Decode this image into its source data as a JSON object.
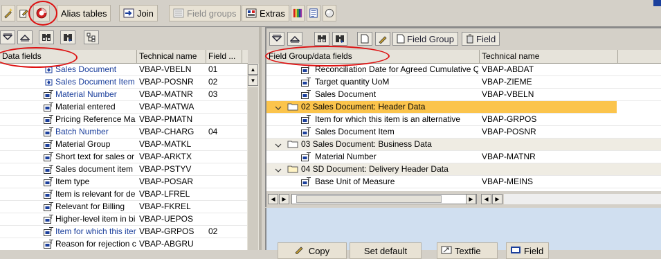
{
  "toolbar": {
    "buttons": [
      {
        "label": "Alias tables"
      },
      {
        "label": "Join"
      },
      {
        "label": "Field groups",
        "disabled": true
      },
      {
        "label": "Extras"
      }
    ]
  },
  "left": {
    "headers": [
      "Data fields",
      "Technical name",
      "Field ..."
    ],
    "rows": [
      {
        "name": "Sales Document",
        "tech": "VBAP-VBELN",
        "group": "01",
        "blue": true,
        "icon": "key-field-icon"
      },
      {
        "name": "Sales Document Item",
        "tech": "VBAP-POSNR",
        "group": "02",
        "blue": true,
        "icon": "key-field-icon"
      },
      {
        "name": "Material Number",
        "tech": "VBAP-MATNR",
        "group": "03",
        "blue": true,
        "icon": "field-icon"
      },
      {
        "name": "Material entered",
        "tech": "VBAP-MATWA",
        "group": "",
        "blue": false,
        "icon": "field-icon"
      },
      {
        "name": "Pricing Reference Ma",
        "tech": "VBAP-PMATN",
        "group": "",
        "blue": false,
        "icon": "field-icon"
      },
      {
        "name": "Batch Number",
        "tech": "VBAP-CHARG",
        "group": "04",
        "blue": true,
        "icon": "field-icon"
      },
      {
        "name": "Material Group",
        "tech": "VBAP-MATKL",
        "group": "",
        "blue": false,
        "icon": "field-icon"
      },
      {
        "name": "Short text for sales or",
        "tech": "VBAP-ARKTX",
        "group": "",
        "blue": false,
        "icon": "field-icon"
      },
      {
        "name": "Sales document item",
        "tech": "VBAP-PSTYV",
        "group": "",
        "blue": false,
        "icon": "field-icon"
      },
      {
        "name": "Item type",
        "tech": "VBAP-POSAR",
        "group": "",
        "blue": false,
        "icon": "field-icon"
      },
      {
        "name": "Item is relevant for de",
        "tech": "VBAP-LFREL",
        "group": "",
        "blue": false,
        "icon": "field-icon"
      },
      {
        "name": "Relevant for Billing",
        "tech": "VBAP-FKREL",
        "group": "",
        "blue": false,
        "icon": "field-icon"
      },
      {
        "name": "Higher-level item in bi",
        "tech": "VBAP-UEPOS",
        "group": "",
        "blue": false,
        "icon": "field-icon"
      },
      {
        "name": "Item for which this iter",
        "tech": "VBAP-GRPOS",
        "group": "02",
        "blue": true,
        "icon": "field-icon"
      },
      {
        "name": "Reason for rejection c",
        "tech": "VBAP-ABGRU",
        "group": "",
        "blue": false,
        "icon": "field-icon"
      }
    ]
  },
  "right": {
    "toolbar_buttons": [
      {
        "label": "Field Group"
      },
      {
        "label": "Field"
      }
    ],
    "headers": [
      "Field Group/data fields",
      "Technical name"
    ],
    "rows": [
      {
        "type": "field",
        "name": "Reconciliation Date for Agreed Cumulative Q",
        "tech": "VBAP-ABDAT"
      },
      {
        "type": "field",
        "name": "Target quantity UoM",
        "tech": "VBAP-ZIEME"
      },
      {
        "type": "field",
        "name": "Sales Document",
        "tech": "VBAP-VBELN"
      },
      {
        "type": "group",
        "name": "02 Sales Document: Header Data",
        "tech": "",
        "selected": true
      },
      {
        "type": "field",
        "name": "Item for which this item is an alternative",
        "tech": "VBAP-GRPOS"
      },
      {
        "type": "field",
        "name": "Sales Document Item",
        "tech": "VBAP-POSNR"
      },
      {
        "type": "group",
        "name": "03 Sales Document: Business Data",
        "tech": "",
        "selected": false
      },
      {
        "type": "field",
        "name": "Material Number",
        "tech": "VBAP-MATNR"
      },
      {
        "type": "group",
        "name": "04 SD Document: Delivery Header Data",
        "tech": "",
        "selected": false
      },
      {
        "type": "field",
        "name": "Base Unit of Measure",
        "tech": "VBAP-MEINS"
      }
    ]
  },
  "bottom": {
    "buttons": [
      {
        "label": "Copy"
      },
      {
        "label": "Set default"
      },
      {
        "label": "Textfie"
      },
      {
        "label": "Field"
      }
    ]
  },
  "colors": {
    "annotation": "#d11111",
    "selection": "#fbc44c",
    "link_blue": "#1b3f9c"
  }
}
